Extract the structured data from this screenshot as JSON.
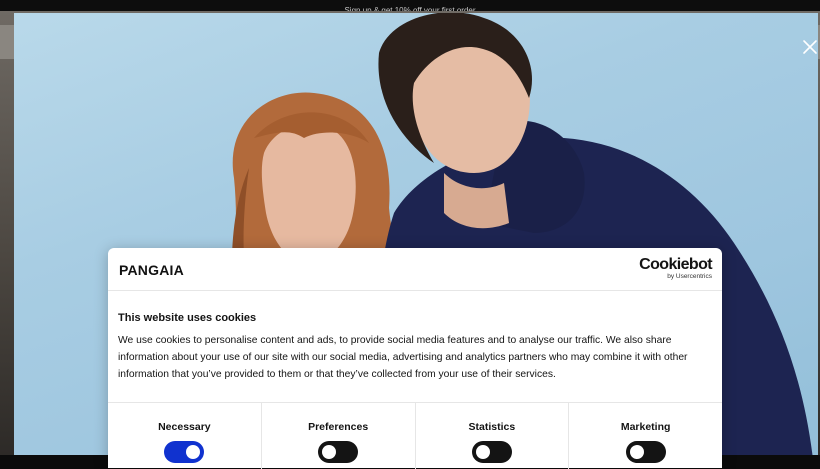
{
  "promo": {
    "text": "Sign up & get 10% off your first order"
  },
  "popup": {
    "close_icon": "close-icon"
  },
  "cookie": {
    "brand": "PANGAIA",
    "provider_name": "Cookiebot",
    "provider_by": "by Usercentrics",
    "title": "This website uses cookies",
    "body": "We use cookies to personalise content and ads, to provide social media features and to analyse our traffic. We also share information about your use of our site with our social media, advertising and analytics partners who may combine it with other information that you’ve provided to them or that they’ve collected from your use of their services.",
    "categories": [
      {
        "label": "Necessary",
        "state": "on"
      },
      {
        "label": "Preferences",
        "state": "off"
      },
      {
        "label": "Statistics",
        "state": "off"
      },
      {
        "label": "Marketing",
        "state": "off"
      }
    ]
  },
  "colors": {
    "accent": "#1032cf",
    "background": "#a8cde3"
  }
}
